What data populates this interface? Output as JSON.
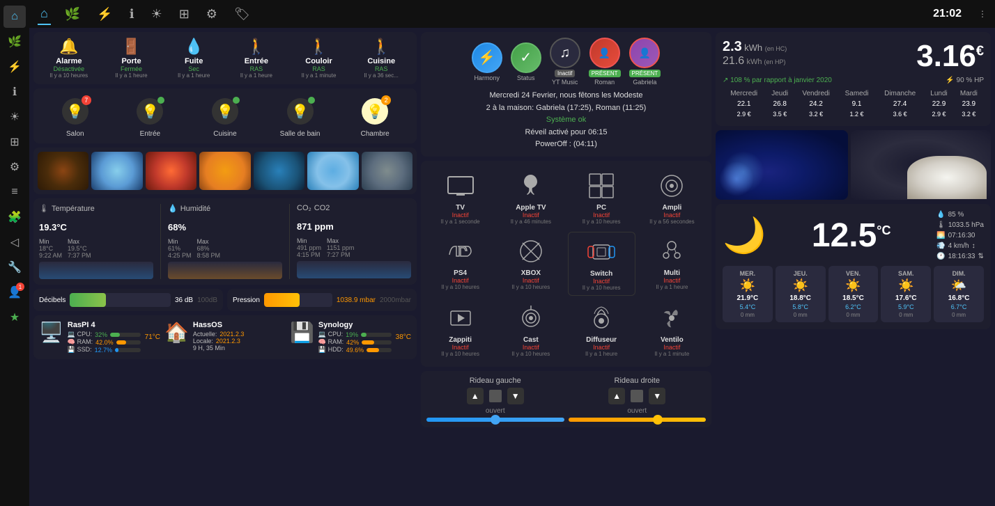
{
  "topnav": {
    "time": "21:02",
    "icons": [
      "home",
      "leaf",
      "lightning",
      "info",
      "brightness",
      "grid",
      "gear",
      "tag"
    ]
  },
  "sidebar": {
    "icons": [
      "grid",
      "person",
      "chart",
      "layers",
      "star",
      "chat",
      "file",
      "puzzle",
      "arrow",
      "tool",
      "person-badge"
    ]
  },
  "alarms": [
    {
      "label": "Alarme",
      "status": "Désactivée",
      "time": "Il y a 10 heures",
      "icon": "🔔",
      "color": "#4caf50"
    },
    {
      "label": "Porte",
      "status": "Fermée",
      "time": "Il y a 1 heure",
      "icon": "🚪",
      "color": "#4caf50"
    },
    {
      "label": "Fuite",
      "status": "Sec",
      "time": "Il y a 1 heure",
      "icon": "💧",
      "color": "#4caf50"
    },
    {
      "label": "Entrée",
      "status": "RAS",
      "time": "Il y a 1 heure",
      "icon": "🚶",
      "color": "#4caf50"
    },
    {
      "label": "Couloir",
      "status": "RAS",
      "time": "Il y a 1 minute",
      "icon": "🚶",
      "color": "#4caf50"
    },
    {
      "label": "Cuisine",
      "status": "RAS",
      "time": "Il y a 36 sec...",
      "icon": "🚶",
      "color": "#f44336"
    }
  ],
  "lights": [
    {
      "label": "Salon",
      "badge": 7,
      "badge_color": "red",
      "on": false
    },
    {
      "label": "Entrée",
      "badge": null,
      "badge_color": "green",
      "on": false
    },
    {
      "label": "Cuisine",
      "badge": null,
      "badge_color": "green",
      "on": false
    },
    {
      "label": "Salle de bain",
      "badge": null,
      "badge_color": "green",
      "on": false
    },
    {
      "label": "Chambre",
      "badge": 2,
      "badge_color": "orange",
      "on": true
    }
  ],
  "sensors": {
    "temperature": {
      "label": "Température",
      "value": "19.3",
      "unit": "°C",
      "min_val": "18°C",
      "min_time": "9:22 AM",
      "max_val": "19.5°C",
      "max_time": "7:37 PM"
    },
    "humidity": {
      "label": "Humidité",
      "value": "68",
      "unit": "%",
      "min_val": "61%",
      "min_time": "4:25 PM",
      "max_val": "68%",
      "max_time": "8:58 PM"
    },
    "co2": {
      "label": "CO2",
      "value": "871",
      "unit": "ppm",
      "min_val": "491 ppm",
      "min_time": "4:15 PM",
      "max_val": "1151 ppm",
      "max_time": "7:27 PM"
    }
  },
  "decibels": {
    "label": "Décibels",
    "value": "36 dB",
    "max": "100dB",
    "fill_pct": 36
  },
  "pressure": {
    "label": "Pression",
    "value": "1038.9 mbar",
    "max": "2000mbar",
    "fill_pct": 52
  },
  "hardware": [
    {
      "name": "RasPI 4",
      "icon": "🖥️",
      "temp": "71°C",
      "cpu": 32,
      "ram": 42,
      "ssd": 12.7
    },
    {
      "name": "HassOS",
      "icon": "🏠",
      "temp": null,
      "actuelle": "2021.2.3",
      "locale": "2021.2.3",
      "uptime": "9 H, 35 Min"
    },
    {
      "name": "Synology",
      "icon": "💾",
      "temp": "38°C",
      "cpu": 19,
      "ram": 42,
      "hdd": 49.6
    }
  ],
  "center": {
    "date_text": "Mercredi 24 Fevrier, nous fêtons les Modeste",
    "home_text": "2 à la maison: Gabriela (17:25), Roman (11:25)",
    "system_text": "Système ok",
    "alarm_text": "Réveil activé pour 06:15",
    "poweroff_text": "PowerOff : (04:11)",
    "users": [
      {
        "name": "Harmony",
        "status": "Harmony",
        "icon": "⚡"
      },
      {
        "name": "Status",
        "status": "Status",
        "icon": "✅"
      },
      {
        "name": "YT Music",
        "status": "Inactif",
        "icon": "♫"
      },
      {
        "name": "Roman",
        "status": "PRÉSENT",
        "icon": "👤"
      },
      {
        "name": "Gabriela",
        "status": "PRÉSENT",
        "icon": "👤"
      }
    ]
  },
  "media": [
    {
      "name": "TV",
      "status": "Inactif",
      "time": "Il y a 1 seconde",
      "icon": "📺"
    },
    {
      "name": "Apple TV",
      "status": "Inactif",
      "time": "Il y a 46 minutes",
      "icon": "🍎"
    },
    {
      "name": "PC",
      "status": "Inactif",
      "time": "Il y a 10 heures",
      "icon": "⊞"
    },
    {
      "name": "Ampli",
      "status": "Inactif",
      "time": "Il y a 56 secondes",
      "icon": "📻"
    },
    {
      "name": "PS4",
      "status": "Inactif",
      "time": "Il y a 10 heures",
      "icon": "🎮"
    },
    {
      "name": "XBOX",
      "status": "Inactif",
      "time": "Il y a 10 heures",
      "icon": "🎮"
    },
    {
      "name": "Switch",
      "status": "Inactif",
      "time": "Il y a 10 heures",
      "icon": "🎮"
    },
    {
      "name": "Multi",
      "status": "Inactif",
      "time": "Il y a 1 heure",
      "icon": "🎮"
    },
    {
      "name": "Zappiti",
      "status": "Inactif",
      "time": "Il y a 10 heures",
      "icon": "🎬"
    },
    {
      "name": "Cast",
      "status": "Inactif",
      "time": "Il y a 10 heures",
      "icon": "📡"
    },
    {
      "name": "Diffuseur",
      "status": "Inactif",
      "time": "Il y a 1 heure",
      "icon": "💨"
    },
    {
      "name": "Ventilo",
      "status": "Inactif",
      "time": "Il y a 1 minute",
      "icon": "🌀"
    }
  ],
  "curtains": [
    {
      "name": "Rideau gauche",
      "state": "ouvert",
      "slider_pct": 50
    },
    {
      "name": "Rideau droite",
      "state": "ouvert",
      "slider_pct": 65
    }
  ],
  "energy": {
    "kwh_hc": "2.3",
    "kwh_hp": "21.6",
    "kwh_hc_label": "(en HC)",
    "kwh_hp_label": "(en HP)",
    "price": "3.16",
    "price_symbol": "€",
    "percent_vs_jan": "108 % par rapport à janvier 2020",
    "percent_hp": "90 % HP",
    "days": [
      "Mercredi",
      "Jeudi",
      "Vendredi",
      "Samedi",
      "Dimanche",
      "Lundi",
      "Mardi"
    ],
    "kwh_vals": [
      "22.1",
      "26.8",
      "24.2",
      "9.1",
      "27.4",
      "22.9",
      "23.9"
    ],
    "euro_vals": [
      "2.9 €",
      "3.5 €",
      "3.2 €",
      "1.2 €",
      "3.6 €",
      "2.9 €",
      "3.2 €"
    ]
  },
  "weather": {
    "current_icon": "🌙",
    "current_temp": "12.5",
    "humidity": "85 %",
    "pressure": "1033.5 hPa",
    "sunrise": "07:16:30",
    "wind_speed": "4 km/h",
    "wind_dir": "km",
    "time": "18:16:33",
    "forecast": [
      {
        "day": "MER.",
        "icon": "☀️",
        "high": "21.9°C",
        "low": "5.4°C",
        "rain": "0 mm"
      },
      {
        "day": "JEU.",
        "icon": "☀️",
        "high": "18.8°C",
        "low": "5.8°C",
        "rain": "0 mm"
      },
      {
        "day": "VEN.",
        "icon": "☀️",
        "high": "18.5°C",
        "low": "6.2°C",
        "rain": "0 mm"
      },
      {
        "day": "SAM.",
        "icon": "☀️",
        "high": "17.6°C",
        "low": "5.9°C",
        "rain": "0 mm"
      },
      {
        "day": "DIM.",
        "icon": "🌤️",
        "high": "16.8°C",
        "low": "6.7°C",
        "rain": "0 mm"
      }
    ]
  }
}
